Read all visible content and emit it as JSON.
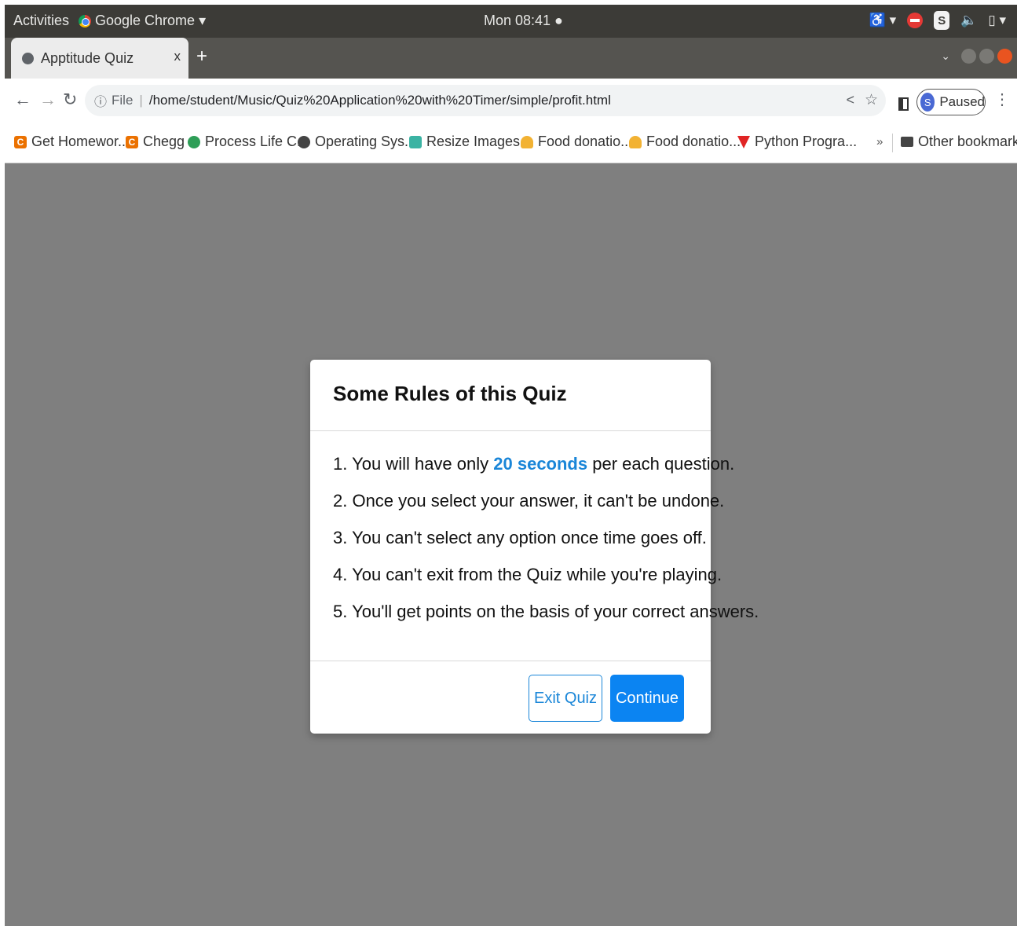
{
  "system_bar": {
    "activities": "Activities",
    "app_name": "Google Chrome ▾",
    "clock": "Mon 08:41 ●",
    "tray_s": "S"
  },
  "tabs": [
    {
      "title": "Apptitude Quiz",
      "close": "x"
    }
  ],
  "new_tab": "+",
  "address_bar": {
    "scheme_label": "File",
    "url": "/home/student/Music/Quiz%20Application%20with%20Timer/simple/profit.html"
  },
  "profile": {
    "initial": "S",
    "status": "Paused"
  },
  "bookmarks": [
    {
      "label": "Get Homewor...",
      "icon": "chegg-icon"
    },
    {
      "label": "Chegg",
      "icon": "chegg-icon"
    },
    {
      "label": "Process Life C...",
      "icon": "process-icon"
    },
    {
      "label": "Operating Sys...",
      "icon": "globe-icon"
    },
    {
      "label": "Resize Images...",
      "icon": "resize-icon"
    },
    {
      "label": "Food donatio...",
      "icon": "food-icon"
    },
    {
      "label": "Food donatio...",
      "icon": "food-icon"
    },
    {
      "label": "Python Progra...",
      "icon": "python-icon"
    }
  ],
  "bookmarks_more": "»",
  "other_bookmarks": "Other bookmarks",
  "modal": {
    "title": "Some Rules of this Quiz",
    "rules": [
      {
        "before": "1. You will have only ",
        "highlight": "20 seconds",
        "after": " per each question."
      },
      {
        "text": "2. Once you select your answer, it can't be undone."
      },
      {
        "text": "3. You can't select any option once time goes off."
      },
      {
        "text": "4. You can't exit from the Quiz while you're playing."
      },
      {
        "text": "5. You'll get points on the basis of your correct answers."
      }
    ],
    "exit_label": "Exit Quiz",
    "continue_label": "Continue"
  },
  "colors": {
    "accent": "#1a86d8",
    "button_primary": "#0b84f2",
    "backdrop": "#7f7f7f"
  }
}
